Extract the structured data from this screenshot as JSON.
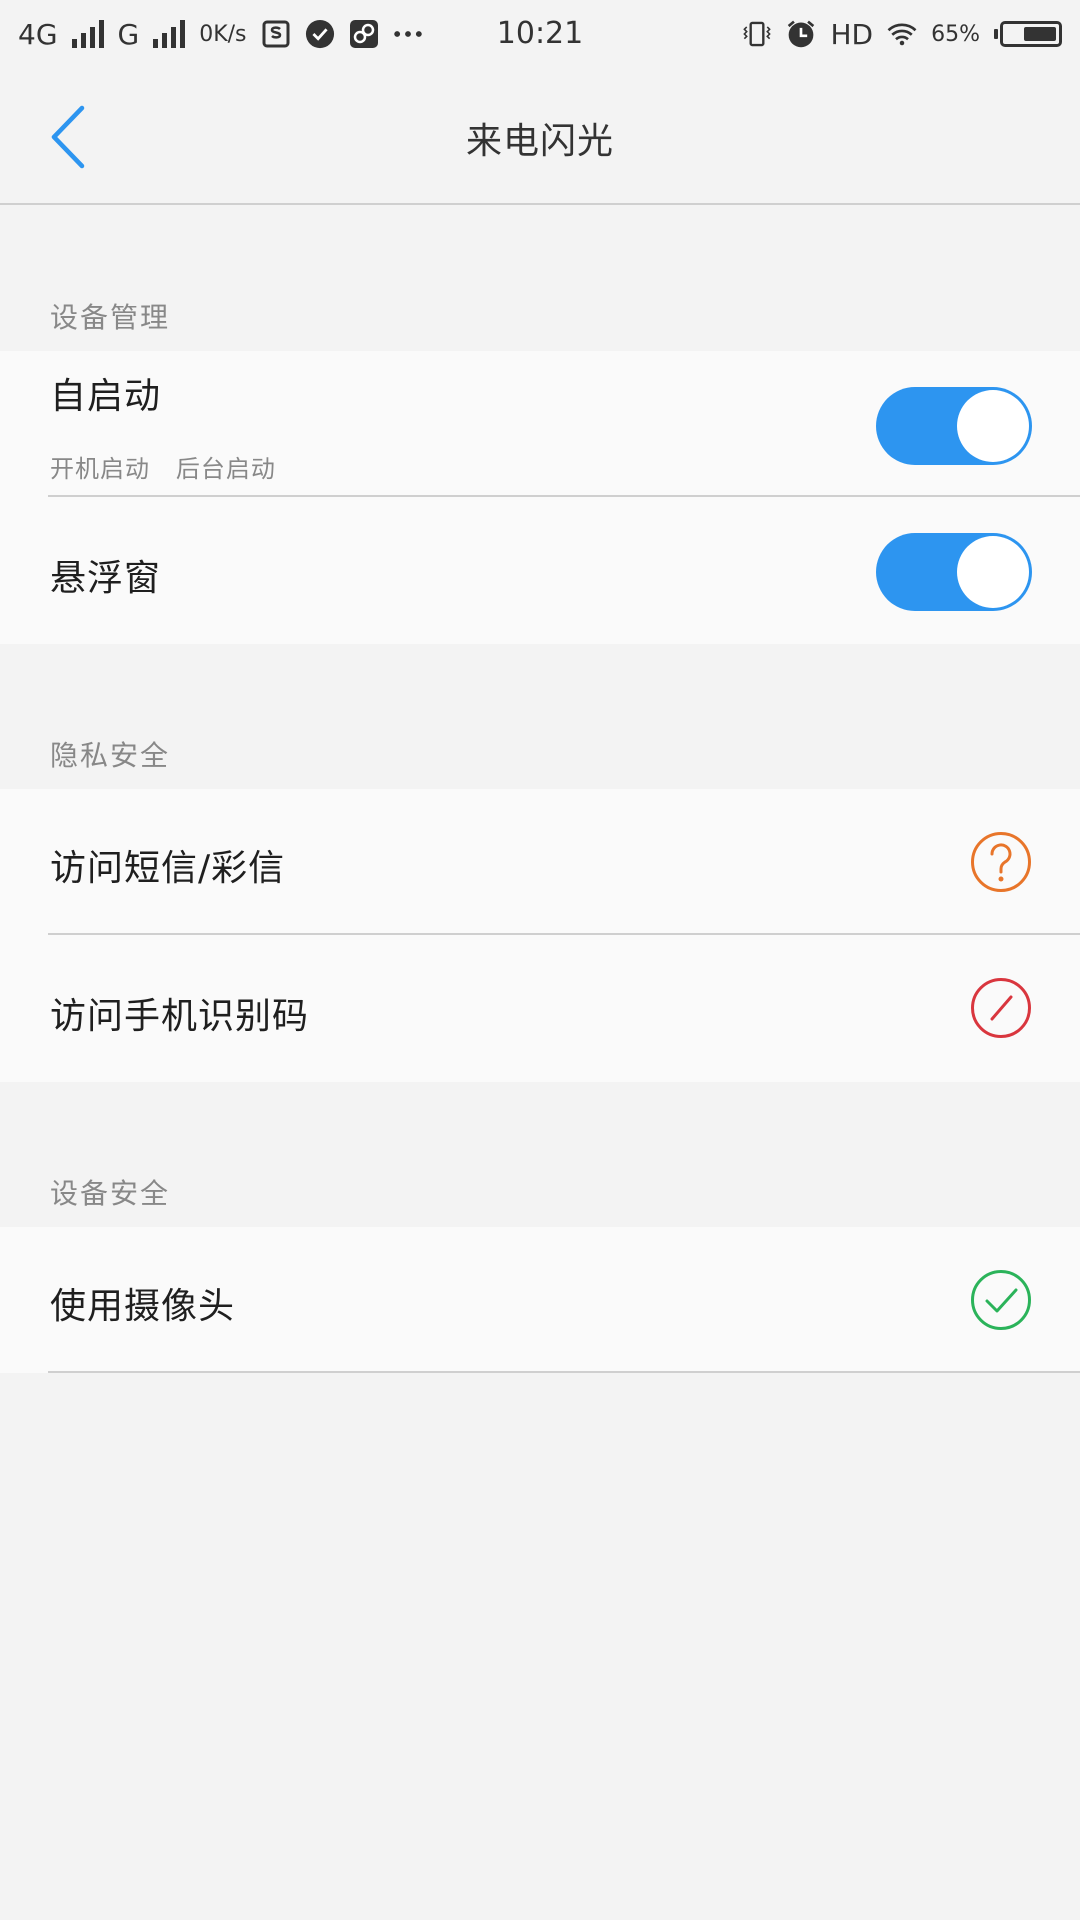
{
  "status_bar": {
    "network_1": "4G",
    "network_2": "G",
    "speed": "0K/s",
    "time": "10:21",
    "hd": "HD",
    "battery_percent": "65%",
    "battery_level": 0.65
  },
  "nav": {
    "title": "来电闪光"
  },
  "sections": {
    "device_management": {
      "header": "设备管理",
      "autostart": {
        "title": "自启动",
        "subtitle": "开机启动   后台启动",
        "enabled": true
      },
      "floating_window": {
        "title": "悬浮窗",
        "enabled": true
      }
    },
    "privacy": {
      "header": "隐私安全",
      "sms": {
        "title": "访问短信/彩信",
        "status_icon": "question-icon"
      },
      "imei": {
        "title": "访问手机识别码",
        "status_icon": "forbidden-icon"
      }
    },
    "device_security": {
      "header": "设备安全",
      "camera": {
        "title": "使用摄像头",
        "status_icon": "check-icon"
      }
    }
  },
  "colors": {
    "accent": "#2d95f0",
    "question": "#e8752a",
    "forbidden": "#d9363e",
    "allowed": "#2bb35a"
  }
}
